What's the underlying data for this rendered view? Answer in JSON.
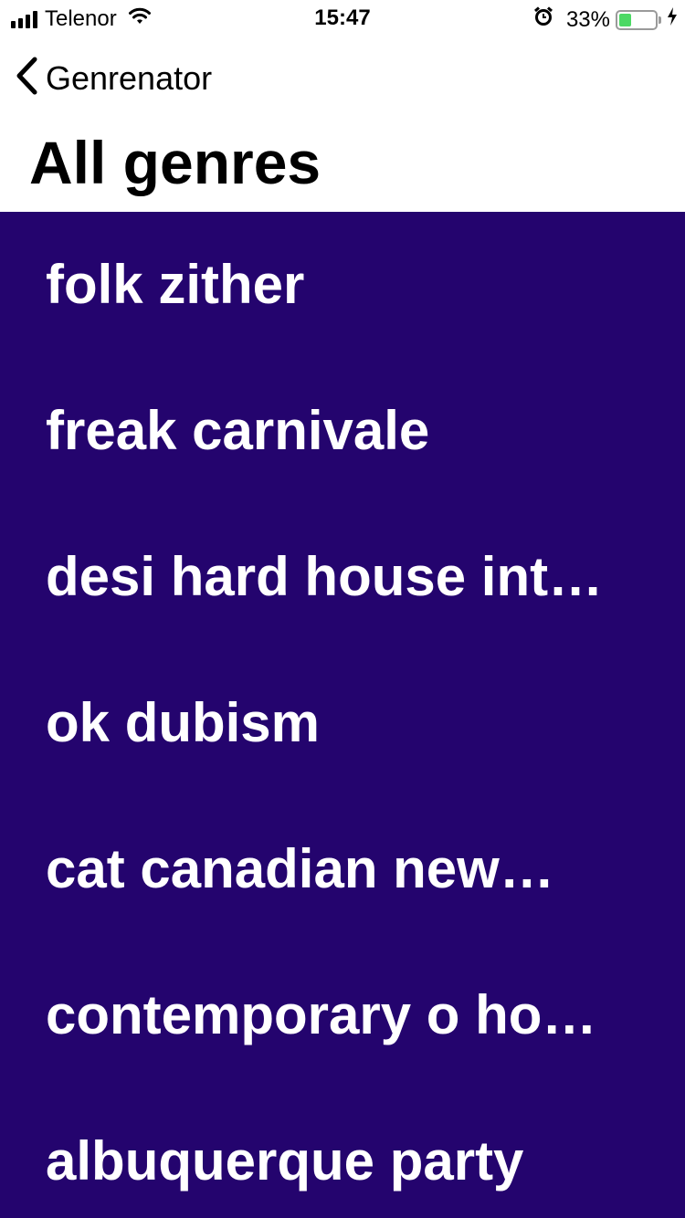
{
  "status_bar": {
    "carrier": "Telenor",
    "time": "15:47",
    "battery_percent": "33%",
    "battery_level": 0.33,
    "icons": [
      "signal-icon",
      "wifi-icon",
      "alarm-icon",
      "battery-icon",
      "charging-bolt-icon"
    ]
  },
  "nav": {
    "back_label": "Genrenator",
    "title": "All genres"
  },
  "colors": {
    "list_background": "#24046e",
    "list_text": "#ffffff",
    "battery_fill": "#4cd964"
  },
  "genres": [
    {
      "label": "folk zither"
    },
    {
      "label": "freak carnivale"
    },
    {
      "label": "desi hard house int…"
    },
    {
      "label": "ok dubism"
    },
    {
      "label": "cat canadian new…"
    },
    {
      "label": "contemporary o ho…"
    },
    {
      "label": "albuquerque party"
    }
  ]
}
